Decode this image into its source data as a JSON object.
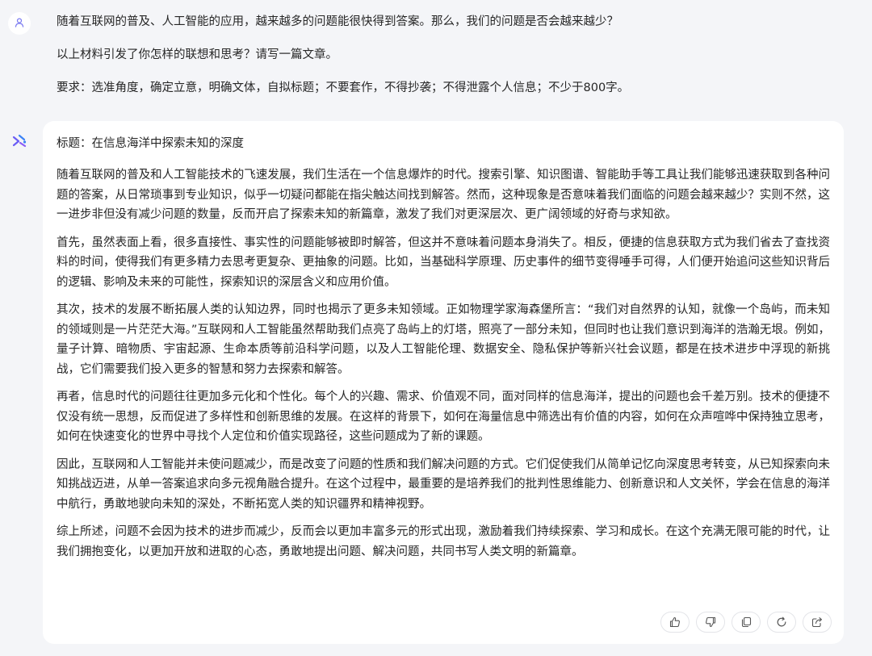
{
  "user": {
    "avatar_icon": "user-icon",
    "messages": [
      "随着互联网的普及、人工智能的应用，越来越多的问题能很快得到答案。那么，我们的问题是否会越来越少？",
      "以上材料引发了你怎样的联想和思考？请写一篇文章。",
      "要求：选准角度，确定立意，明确文体，自拟标题；不要套作，不得抄袭；不得泄露个人信息；不少于800字。"
    ]
  },
  "assistant": {
    "avatar_icon": "assistant-logo-icon",
    "title": "标题：在信息海洋中探索未知的深度",
    "paragraphs": [
      "随着互联网的普及和人工智能技术的飞速发展，我们生活在一个信息爆炸的时代。搜索引擎、知识图谱、智能助手等工具让我们能够迅速获取到各种问题的答案，从日常琐事到专业知识，似乎一切疑问都能在指尖触达间找到解答。然而，这种现象是否意味着我们面临的问题会越来越少？实则不然，这一进步非但没有减少问题的数量，反而开启了探索未知的新篇章，激发了我们对更深层次、更广阔领域的好奇与求知欲。",
      "首先，虽然表面上看，很多直接性、事实性的问题能够被即时解答，但这并不意味着问题本身消失了。相反，便捷的信息获取方式为我们省去了查找资料的时间，使得我们有更多精力去思考更复杂、更抽象的问题。比如，当基础科学原理、历史事件的细节变得唾手可得，人们便开始追问这些知识背后的逻辑、影响及未来的可能性，探索知识的深层含义和应用价值。",
      "其次，技术的发展不断拓展人类的认知边界，同时也揭示了更多未知领域。正如物理学家海森堡所言：“我们对自然界的认知，就像一个岛屿，而未知的领域则是一片茫茫大海。”互联网和人工智能虽然帮助我们点亮了岛屿上的灯塔，照亮了一部分未知，但同时也让我们意识到海洋的浩瀚无垠。例如，量子计算、暗物质、宇宙起源、生命本质等前沿科学问题，以及人工智能伦理、数据安全、隐私保护等新兴社会议题，都是在技术进步中浮现的新挑战，它们需要我们投入更多的智慧和努力去探索和解答。",
      "再者，信息时代的问题往往更加多元化和个性化。每个人的兴趣、需求、价值观不同，面对同样的信息海洋，提出的问题也会千差万别。技术的便捷不仅没有统一思想，反而促进了多样性和创新思维的发展。在这样的背景下，如何在海量信息中筛选出有价值的内容，如何在众声喧哗中保持独立思考，如何在快速变化的世界中寻找个人定位和价值实现路径，这些问题成为了新的课题。",
      "因此，互联网和人工智能并未使问题减少，而是改变了问题的性质和我们解决问题的方式。它们促使我们从简单记忆向深度思考转变，从已知探索向未知挑战迈进，从单一答案追求向多元视角融合提升。在这个过程中，最重要的是培养我们的批判性思维能力、创新意识和人文关怀，学会在信息的海洋中航行，勇敢地驶向未知的深处，不断拓宽人类的知识疆界和精神视野。",
      "综上所述，问题不会因为技术的进步而减少，反而会以更加丰富多元的形式出现，激励着我们持续探索、学习和成长。在这个充满无限可能的时代，让我们拥抱变化，以更加开放和进取的心态，勇敢地提出问题、解决问题，共同书写人类文明的新篇章。"
    ],
    "actions": [
      {
        "icon": "thumbs-up-icon"
      },
      {
        "icon": "thumbs-down-icon"
      },
      {
        "icon": "copy-icon"
      },
      {
        "icon": "regenerate-icon"
      },
      {
        "icon": "share-icon"
      }
    ]
  },
  "colors": {
    "background": "#f4f5f8",
    "card": "#ffffff",
    "text": "#262626",
    "icon": "#555555",
    "brand_primary": "#6a5cf6",
    "brand_secondary": "#3b82f6"
  }
}
